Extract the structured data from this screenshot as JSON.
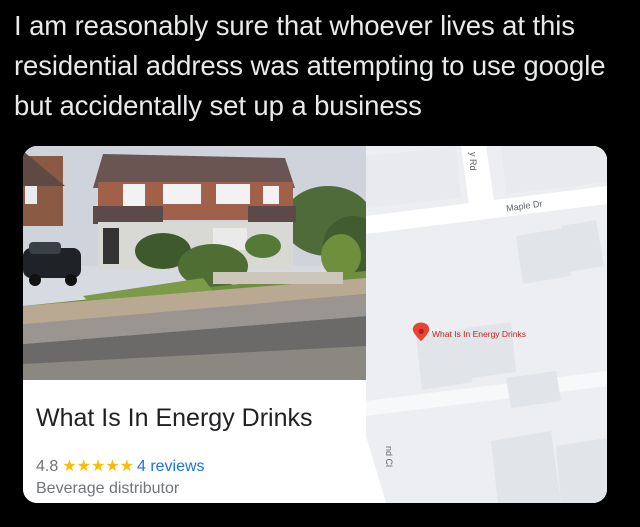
{
  "tweet": {
    "text": "I am reasonably sure that whoever lives at this residential address was attempting to use google but accidentally set up a business"
  },
  "business": {
    "name": "What Is In Energy Drinks",
    "rating": "4.8",
    "stars": "★★★★★",
    "reviews": "4 reviews",
    "category": "Beverage distributor"
  },
  "map": {
    "street_1": "Maple Dr",
    "street_2": "y Rd",
    "street_3": "nd Cl",
    "pin_label": "What Is In Energy Drinks",
    "pin_color": "#ea4335"
  },
  "colors": {
    "background": "#000000",
    "tweet_text": "#e7e9ea",
    "star": "#fbbc04",
    "link": "#1a73e8"
  }
}
